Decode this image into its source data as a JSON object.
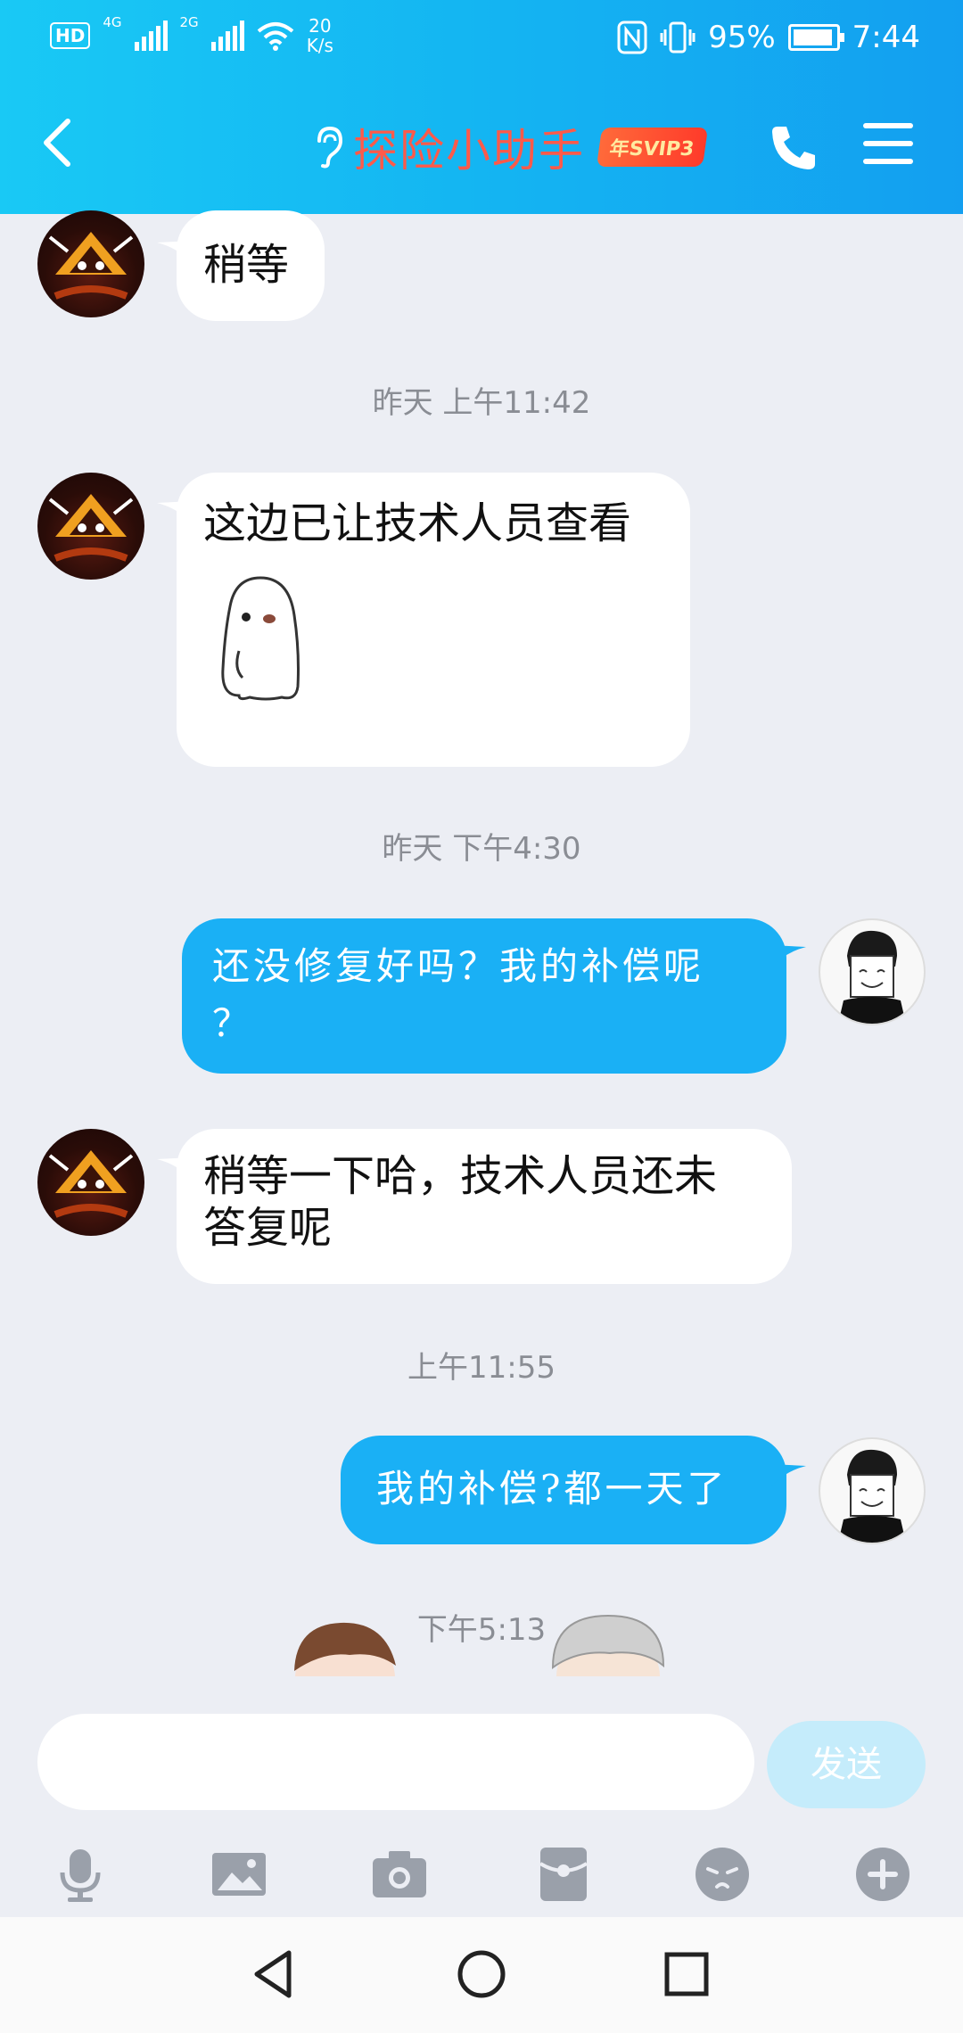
{
  "status_bar": {
    "hd": "HD",
    "net1": "4G",
    "net2": "2G",
    "speed_value": "20",
    "speed_unit": "K/s",
    "battery": "95%",
    "time": "7:44"
  },
  "header": {
    "title": "探险小助手",
    "badge": "年SVIP3",
    "title_color": "#ff5a4a",
    "bg_color": "#14b5f2"
  },
  "messages": [
    {
      "from": "bot",
      "text": "稍等"
    },
    {
      "timestamp": "昨天 上午11:42"
    },
    {
      "from": "bot",
      "text": "这边已让技术人员查看",
      "sticker": "ghost-sticker"
    },
    {
      "timestamp": "昨天 下午4:30"
    },
    {
      "from": "me",
      "text_line1": "还没修复好吗？我的补偿呢",
      "text_line2": "？"
    },
    {
      "from": "bot",
      "text_line1": "稍等一下哈，技术人员还未",
      "text_line2": "答复呢"
    },
    {
      "timestamp": "上午11:55"
    },
    {
      "from": "me",
      "text": "我的补偿?都一天了"
    },
    {
      "timestamp": "下午5:13"
    }
  ],
  "input": {
    "placeholder": "",
    "send_label": "发送"
  },
  "toolbar": [
    "mic-icon",
    "image-icon",
    "camera-icon",
    "red-packet-icon",
    "emoji-icon",
    "plus-icon"
  ],
  "nav": [
    "back-triangle-icon",
    "home-circle-icon",
    "recent-square-icon"
  ]
}
